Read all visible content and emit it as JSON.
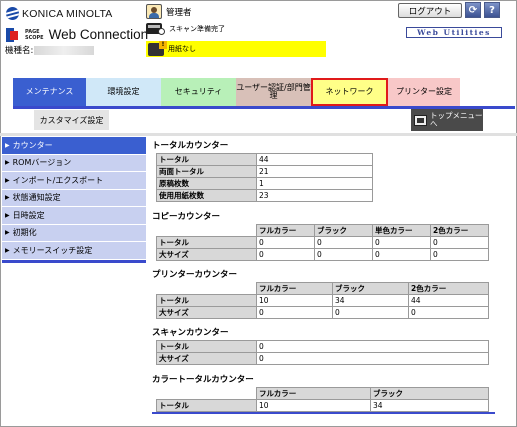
{
  "header": {
    "brand": "KONICA MINOLTA",
    "pagescope_top": "PAGE",
    "pagescope_bottom": "SCOPE",
    "product": "Web Connection",
    "device_label": "機種名:",
    "user": "管理者",
    "scan_status": "スキャン準備完了",
    "paper_status": "用紙なし",
    "logout_label": "ログアウト",
    "web_utilities": "Web Utilities",
    "paper_status_color": "#ffff00"
  },
  "tabs": [
    {
      "label": "メンテナンス",
      "color": "#3a5fd0"
    },
    {
      "label": "環境設定",
      "color": "#d0e8f8"
    },
    {
      "label": "セキュリティ",
      "color": "#b8f0b8"
    },
    {
      "label": "ユーザー認証/部門管理",
      "color": "#d8c0b8"
    },
    {
      "label": "ネットワーク",
      "color": "#ffff88"
    },
    {
      "label": "プリンター設定",
      "color": "#f8c8c8"
    }
  ],
  "subtabs": [
    {
      "label": "カスタマイズ設定"
    }
  ],
  "top_menu": {
    "label": "トップメニューへ"
  },
  "sidebar": {
    "items": [
      {
        "label": "カウンター"
      },
      {
        "label": "ROMバージョン"
      },
      {
        "label": "インポート/エクスポート"
      },
      {
        "label": "状態通知設定"
      },
      {
        "label": "日時設定"
      },
      {
        "label": "初期化"
      },
      {
        "label": "メモリースイッチ設定"
      }
    ]
  },
  "total_counter": {
    "title": "トータルカウンター",
    "rows": [
      {
        "label": "トータル",
        "value": "44"
      },
      {
        "label": "両面トータル",
        "value": "21"
      },
      {
        "label": "原稿枚数",
        "value": "1"
      },
      {
        "label": "使用用紙枚数",
        "value": "23"
      }
    ]
  },
  "copy_counter": {
    "title": "コピーカウンター",
    "columns": [
      "フルカラー",
      "ブラック",
      "単色カラー",
      "2色カラー"
    ],
    "rows": [
      {
        "label": "トータル",
        "values": [
          "0",
          "0",
          "0",
          "0"
        ]
      },
      {
        "label": "大サイズ",
        "values": [
          "0",
          "0",
          "0",
          "0"
        ]
      }
    ]
  },
  "printer_counter": {
    "title": "プリンターカウンター",
    "columns": [
      "フルカラー",
      "ブラック",
      "2色カラー"
    ],
    "rows": [
      {
        "label": "トータル",
        "values": [
          "10",
          "34",
          "44"
        ]
      },
      {
        "label": "大サイズ",
        "values": [
          "0",
          "0",
          "0"
        ]
      }
    ]
  },
  "scan_counter": {
    "title": "スキャンカウンター",
    "rows": [
      {
        "label": "トータル",
        "value": "0"
      },
      {
        "label": "大サイズ",
        "value": "0"
      }
    ]
  },
  "color_total_counter": {
    "title": "カラートータルカウンター",
    "columns": [
      "フルカラー",
      "ブラック"
    ],
    "rows": [
      {
        "label": "トータル",
        "values": [
          "10",
          "34"
        ]
      }
    ]
  }
}
